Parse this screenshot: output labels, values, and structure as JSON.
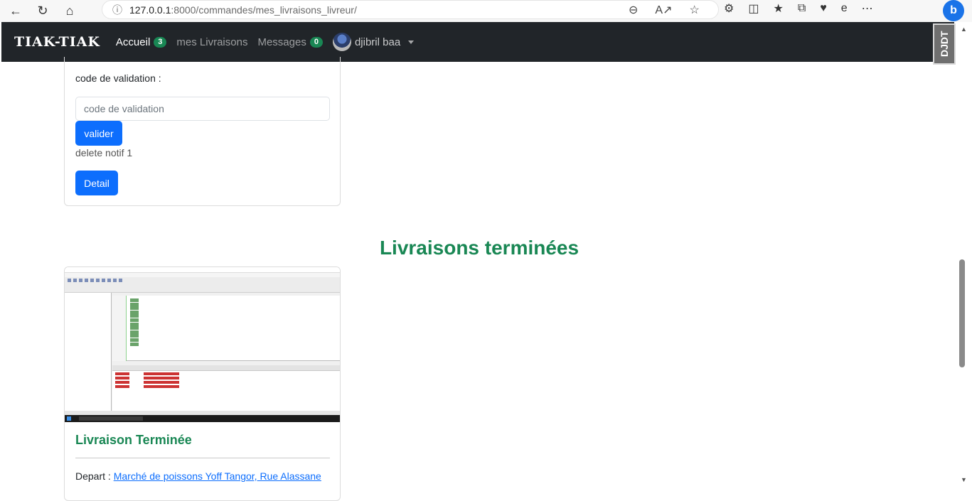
{
  "browser": {
    "url_host": "127.0.0.1",
    "url_path": ":8000/commandes/mes_livraisons_livreur/"
  },
  "navbar": {
    "brand": "TIAK-TIAK",
    "links": [
      {
        "label": "Accueil",
        "badge": "3",
        "active": true
      },
      {
        "label": "mes Livraisons"
      },
      {
        "label": "Messages",
        "badge": "0"
      }
    ],
    "user": "djibril baa",
    "corner_logo": "DJDT"
  },
  "card1": {
    "code_label": "code de validation :",
    "code_placeholder": "code de validation",
    "valider_label": "valider",
    "note": "delete notif 1",
    "detail_label": "Detail"
  },
  "section": {
    "title": "Livraisons terminées"
  },
  "card2": {
    "title": "Livraison Terminée",
    "depart_label": "Depart : ",
    "depart_link": "Marché de poissons Yoff Tangor, Rue Alassane"
  }
}
